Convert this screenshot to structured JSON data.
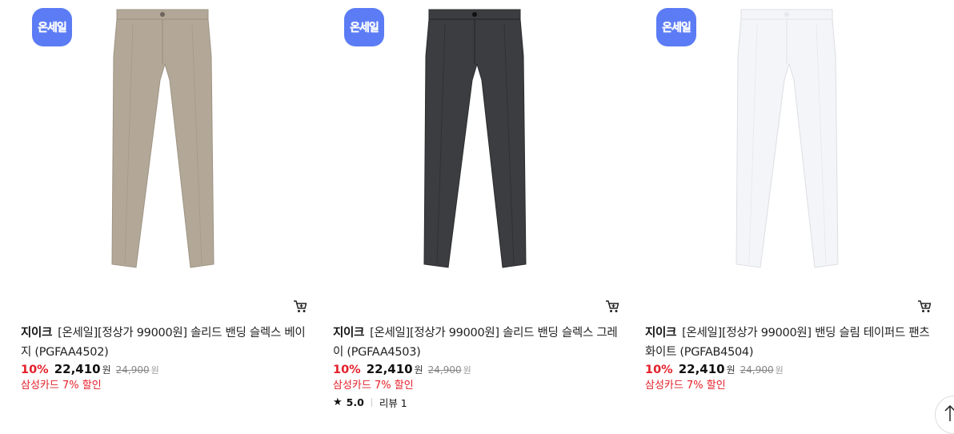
{
  "products": [
    {
      "badge": "온세일",
      "brand": "지이크",
      "name": "[온세일][정상가 99000원] 솔리드 밴딩 슬렉스 베이지 (PGFAA4502)",
      "discount": "10%",
      "price": "22,410",
      "price_unit": "원",
      "original_price": "24,900",
      "original_unit": "원",
      "promo": "삼성카드 7% 할인",
      "color": "#b3a898"
    },
    {
      "badge": "온세일",
      "brand": "지이크",
      "name": "[온세일][정상가 99000원] 솔리드 밴딩 슬렉스 그레이 (PGFAA4503)",
      "discount": "10%",
      "price": "22,410",
      "price_unit": "원",
      "original_price": "24,900",
      "original_unit": "원",
      "promo": "삼성카드 7% 할인",
      "rating": "5.0",
      "review": "리뷰 1",
      "color": "#3c3d40"
    },
    {
      "badge": "온세일",
      "brand": "지이크",
      "name": "[온세일][정상가 99000원] 밴딩 슬림 테이퍼드 팬츠 화이트 (PGFAB4504)",
      "discount": "10%",
      "price": "22,410",
      "price_unit": "원",
      "original_price": "24,900",
      "original_unit": "원",
      "promo": "삼성카드 7% 할인",
      "color": "#f4f5f8"
    }
  ],
  "icons": {
    "cart": "cart-icon",
    "star": "star-icon",
    "scroll_top": "arrow-up-icon"
  }
}
